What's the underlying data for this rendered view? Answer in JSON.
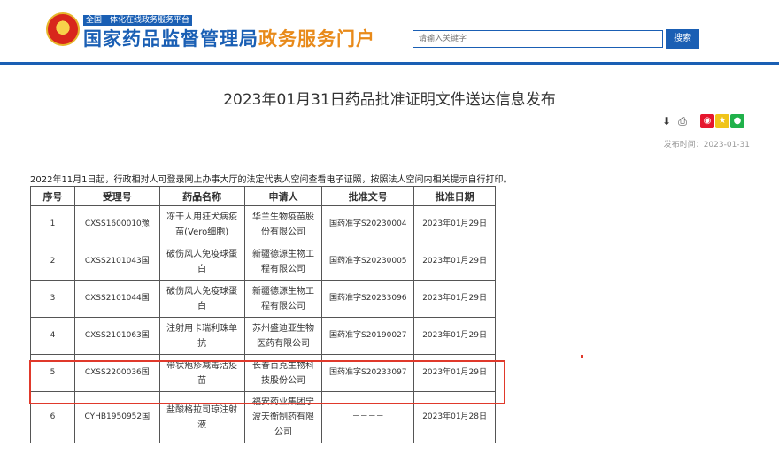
{
  "header": {
    "sub_title": "全国一体化在线政务服务平台",
    "main_title": "国家药品监督管理局",
    "main_title_accent": "政务服务门户",
    "search_placeholder": "请输入关键字",
    "search_button": "搜索"
  },
  "article": {
    "title": "2023年01月31日药品批准证明文件送达信息发布",
    "publish_time": "发布时间：2023-01-31",
    "notice": "2022年11月1日起，行政相对人可登录网上办事大厅的法定代表人空间查看电子证照，按照法人空间内相关提示自行打印。"
  },
  "tools": {
    "download_icon": "download-icon",
    "print_icon": "print-icon",
    "weibo_icon": "weibo-icon",
    "qzone_icon": "qzone-icon",
    "wechat_icon": "wechat-icon"
  },
  "table": {
    "headers": [
      "序号",
      "受理号",
      "药品名称",
      "申请人",
      "批准文号",
      "批准日期"
    ],
    "rows": [
      {
        "no": "1",
        "accept": "CXSS1600010豫",
        "name": "冻干人用狂犬病疫苗(Vero细胞)",
        "applicant": "华兰生物疫苗股份有限公司",
        "approval": "国药准字S20230004",
        "date": "2023年01月29日"
      },
      {
        "no": "2",
        "accept": "CXSS2101043国",
        "name": "破伤风人免疫球蛋白",
        "applicant": "新疆德源生物工程有限公司",
        "approval": "国药准字S20230005",
        "date": "2023年01月29日"
      },
      {
        "no": "3",
        "accept": "CXSS2101044国",
        "name": "破伤风人免疫球蛋白",
        "applicant": "新疆德源生物工程有限公司",
        "approval": "国药准字S20233096",
        "date": "2023年01月29日"
      },
      {
        "no": "4",
        "accept": "CXSS2101063国",
        "name": "注射用卡瑞利珠单抗",
        "applicant": "苏州盛迪亚生物医药有限公司",
        "approval": "国药准字S20190027",
        "date": "2023年01月29日"
      },
      {
        "no": "5",
        "accept": "CXSS2200036国",
        "name": "带状疱疹减毒活疫苗",
        "applicant": "长春百克生物科技股份公司",
        "approval": "国药准字S20233097",
        "date": "2023年01月29日"
      },
      {
        "no": "6",
        "accept": "CYHB1950952国",
        "name": "盐酸格拉司琼注射液",
        "applicant": "福安药业集团宁波天衡制药有限公司",
        "approval": "－－－－",
        "date": "2023年01月28日"
      }
    ]
  },
  "colors": {
    "brand_blue": "#1a5fb4",
    "accent_orange": "#e88a1a",
    "highlight_red": "#e0392b"
  }
}
